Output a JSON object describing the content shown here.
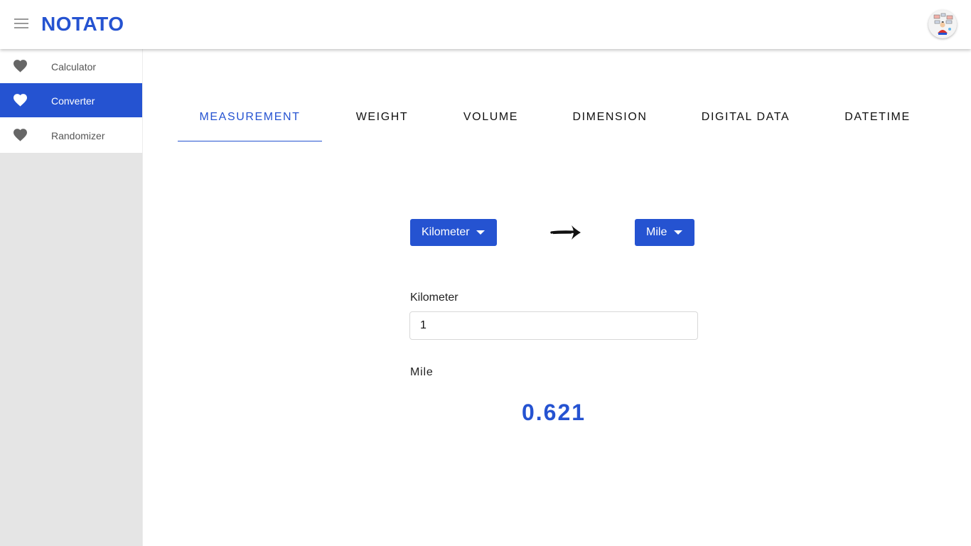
{
  "header": {
    "brand": "NOTATO",
    "menu_icon": "hamburger-menu-icon",
    "avatar_icon": "user-avatar-icon"
  },
  "sidebar": {
    "items": [
      {
        "label": "Calculator",
        "icon": "heart-icon",
        "active": false
      },
      {
        "label": "Converter",
        "icon": "heart-icon",
        "active": true
      },
      {
        "label": "Randomizer",
        "icon": "heart-icon",
        "active": false
      }
    ]
  },
  "tabs": [
    {
      "label": "MEASUREMENT",
      "active": true
    },
    {
      "label": "WEIGHT",
      "active": false
    },
    {
      "label": "VOLUME",
      "active": false
    },
    {
      "label": "DIMENSION",
      "active": false
    },
    {
      "label": "DIGITAL DATA",
      "active": false
    },
    {
      "label": "DATETIME",
      "active": false
    }
  ],
  "converter": {
    "from_unit": "Kilometer",
    "to_unit": "Mile",
    "arrow_icon": "right-arrow-icon",
    "input_label": "Kilometer",
    "input_value": "1",
    "output_label": "Mile",
    "output_value": "0.621"
  },
  "colors": {
    "accent": "#2553d1",
    "sidebar_bg": "#e5e5e5",
    "icon_gray": "#666666"
  }
}
